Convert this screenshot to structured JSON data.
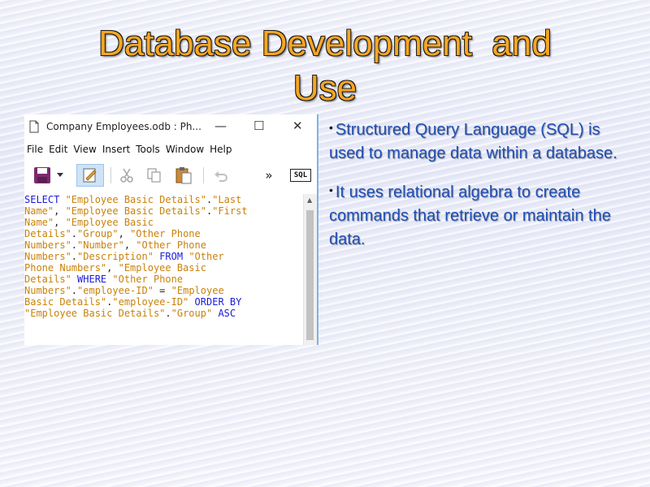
{
  "slide": {
    "title_line1": "Database Development  and",
    "title_line2": "Use"
  },
  "window": {
    "title": "Company Employees.odb : Ph...",
    "controls": {
      "minimize": "—",
      "maximize": "☐",
      "close": "✕"
    },
    "menu": [
      "File",
      "Edit",
      "View",
      "Insert",
      "Tools",
      "Window",
      "Help"
    ],
    "toolbar": {
      "overflow": "»",
      "sql_label": "SQL",
      "icons": [
        "save-icon",
        "dropdown-arrow-icon",
        "edit-icon",
        "cut-icon",
        "copy-icon",
        "paste-icon",
        "undo-icon",
        "sql-icon"
      ]
    },
    "sql_lines": [
      [
        [
          "kw",
          "SELECT "
        ],
        [
          "str",
          "\"Employee Basic Details\""
        ],
        [
          "pl",
          "."
        ],
        [
          "str",
          "\"Last"
        ]
      ],
      [
        [
          "str",
          "Name\""
        ],
        [
          "pl",
          ", "
        ],
        [
          "str",
          "\"Employee Basic Details\""
        ],
        [
          "pl",
          "."
        ],
        [
          "str",
          "\"First"
        ]
      ],
      [
        [
          "str",
          "Name\""
        ],
        [
          "pl",
          ", "
        ],
        [
          "str",
          "\"Employee Basic"
        ]
      ],
      [
        [
          "str",
          "Details\""
        ],
        [
          "pl",
          "."
        ],
        [
          "str",
          "\"Group\""
        ],
        [
          "pl",
          ", "
        ],
        [
          "str",
          "\"Other Phone"
        ]
      ],
      [
        [
          "str",
          "Numbers\""
        ],
        [
          "pl",
          "."
        ],
        [
          "str",
          "\"Number\""
        ],
        [
          "pl",
          ", "
        ],
        [
          "str",
          "\"Other Phone"
        ]
      ],
      [
        [
          "str",
          "Numbers\""
        ],
        [
          "pl",
          "."
        ],
        [
          "str",
          "\"Description\""
        ],
        [
          "pl",
          " "
        ],
        [
          "kw",
          "FROM "
        ],
        [
          "str",
          "\"Other"
        ]
      ],
      [
        [
          "str",
          "Phone Numbers\""
        ],
        [
          "pl",
          ", "
        ],
        [
          "str",
          "\"Employee Basic"
        ]
      ],
      [
        [
          "str",
          "Details\""
        ],
        [
          "pl",
          " "
        ],
        [
          "kw",
          "WHERE "
        ],
        [
          "str",
          "\"Other Phone"
        ]
      ],
      [
        [
          "str",
          "Numbers\""
        ],
        [
          "pl",
          "."
        ],
        [
          "str",
          "\"employee-ID\""
        ],
        [
          "pl",
          " = "
        ],
        [
          "str",
          "\"Employee"
        ]
      ],
      [
        [
          "str",
          "Basic Details\""
        ],
        [
          "pl",
          "."
        ],
        [
          "str",
          "\"employee-ID\""
        ],
        [
          "pl",
          " "
        ],
        [
          "kw",
          "ORDER BY"
        ]
      ],
      [
        [
          "str",
          "\"Employee Basic Details\""
        ],
        [
          "pl",
          "."
        ],
        [
          "str",
          "\"Group\""
        ],
        [
          "pl",
          " "
        ],
        [
          "kw",
          "ASC"
        ]
      ]
    ]
  },
  "bullets": [
    "Structured Query Language (SQL) is used to manage data within a database.",
    "It uses relational algebra to create commands that retrieve or maintain the data."
  ],
  "colors": {
    "title": "#f6a623",
    "bullet_text": "#1f4fb5",
    "sql_keyword": "#1b1bd8",
    "sql_string": "#c9820a"
  }
}
